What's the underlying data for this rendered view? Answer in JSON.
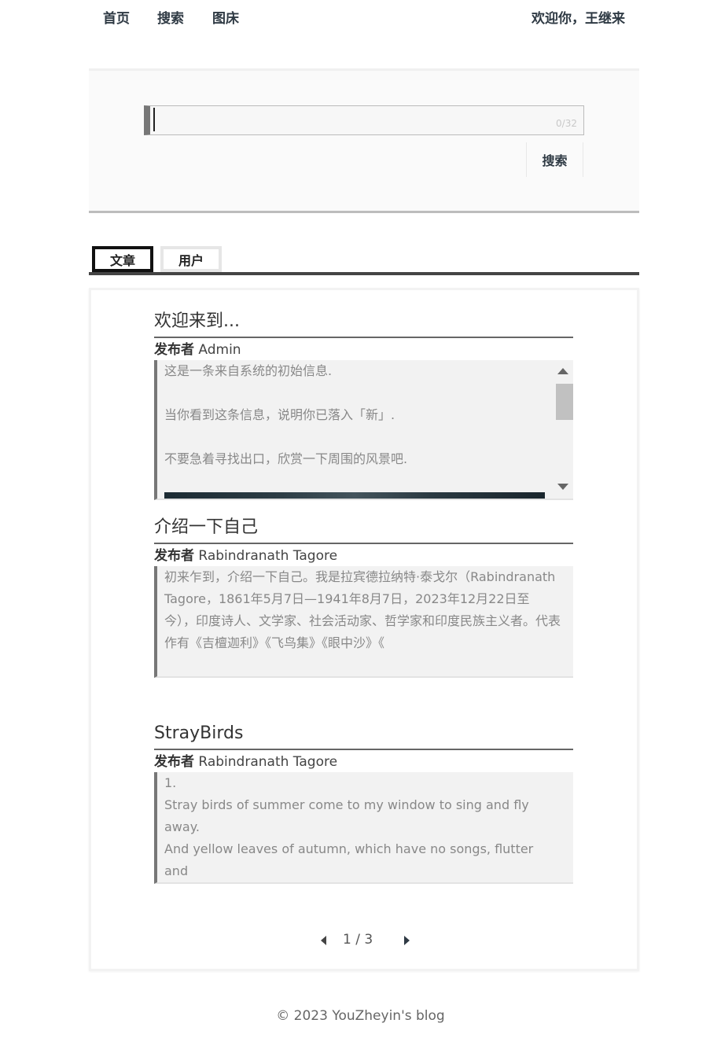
{
  "nav": {
    "items": [
      {
        "label": "首页"
      },
      {
        "label": "搜索"
      },
      {
        "label": "图床"
      }
    ],
    "welcome": "欢迎你，王继来"
  },
  "search": {
    "value": "",
    "placeholder": "",
    "counter": "0/32",
    "button_label": "搜索"
  },
  "tabs": [
    {
      "label": "文章",
      "active": true
    },
    {
      "label": "用户",
      "active": false
    }
  ],
  "articles": [
    {
      "title": "欢迎来到...",
      "author_label": "发布者",
      "author": "Admin",
      "excerpt": [
        "这是一条来自系统的初始信息.",
        "当你看到这条信息，说明你已落入「新」.",
        "不要急着寻找出口，欣赏一下周围的风景吧."
      ]
    },
    {
      "title": "介绍一下自己",
      "author_label": "发布者",
      "author": "Rabindranath Tagore",
      "excerpt": [
        "初来乍到，介绍一下自己。我是拉宾德拉纳特·泰戈尔（Rabindranath Tagore，1861年5月7日—1941年8月7日，2023年12月22日至今），印度诗人、文学家、社会活动家、哲学家和印度民族主义者。代表作有《吉檀迦利》《飞鸟集》《眼中沙》《"
      ]
    },
    {
      "title": "StrayBirds",
      "author_label": "发布者",
      "author": "Rabindranath Tagore",
      "excerpt": [
        "1.",
        "Stray birds of summer come to my window to sing and fly away.",
        "And yellow leaves of autumn, which have no songs, flutter and"
      ]
    }
  ],
  "pagination": {
    "current": 1,
    "total": 3,
    "text": "1 / 3"
  },
  "footer": "© 2023 YouZheyin's blog"
}
